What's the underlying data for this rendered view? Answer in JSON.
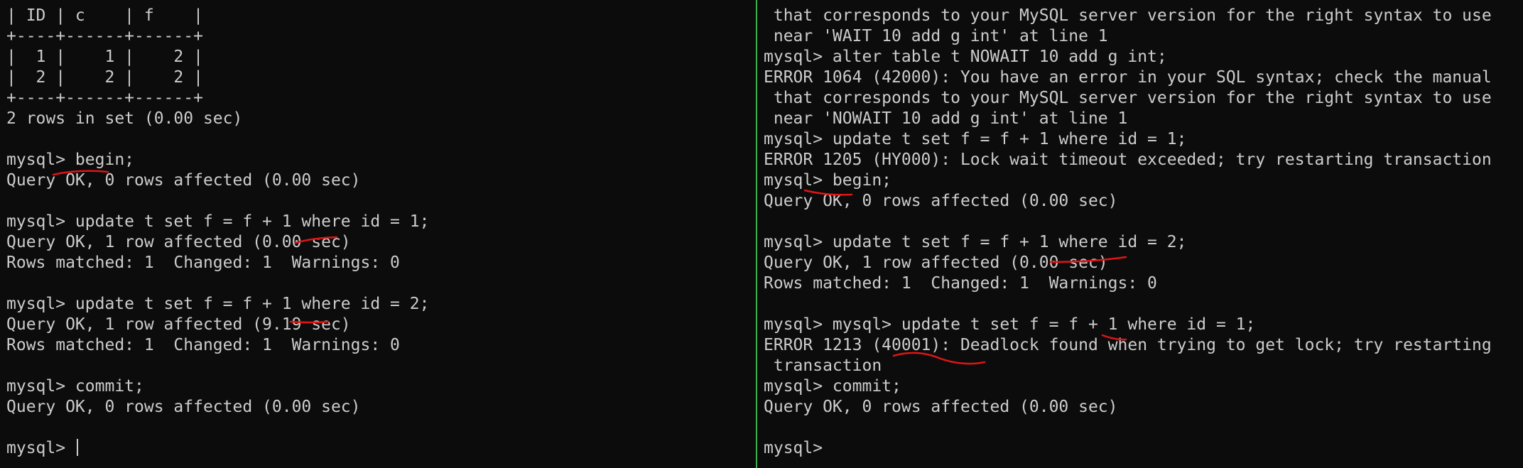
{
  "left_pane": {
    "lines": [
      "| ID | c    | f    |",
      "+----+------+------+",
      "|  1 |    1 |    2 |",
      "|  2 |    2 |    2 |",
      "+----+------+------+",
      "2 rows in set (0.00 sec)",
      "",
      "mysql> begin;",
      "Query OK, 0 rows affected (0.00 sec)",
      "",
      "mysql> update t set f = f + 1 where id = 1;",
      "Query OK, 1 row affected (0.00 sec)",
      "Rows matched: 1  Changed: 1  Warnings: 0",
      "",
      "mysql> update t set f = f + 1 where id = 2;",
      "Query OK, 1 row affected (9.19 sec)",
      "Rows matched: 1  Changed: 1  Warnings: 0",
      "",
      "mysql> commit;",
      "Query OK, 0 rows affected (0.00 sec)",
      "",
      "mysql> "
    ]
  },
  "right_pane": {
    "lines": [
      " that corresponds to your MySQL server version for the right syntax to use",
      " near 'WAIT 10 add g int' at line 1",
      "mysql> alter table t NOWAIT 10 add g int;",
      "ERROR 1064 (42000): You have an error in your SQL syntax; check the manual",
      " that corresponds to your MySQL server version for the right syntax to use",
      " near 'NOWAIT 10 add g int' at line 1",
      "mysql> update t set f = f + 1 where id = 1;",
      "ERROR 1205 (HY000): Lock wait timeout exceeded; try restarting transaction",
      "mysql> begin;",
      "Query OK, 0 rows affected (0.00 sec)",
      "",
      "mysql> update t set f = f + 1 where id = 2;",
      "Query OK, 1 row affected (0.00 sec)",
      "Rows matched: 1  Changed: 1  Warnings: 0",
      "",
      "mysql> mysql> update t set f = f + 1 where id = 1;",
      "ERROR 1213 (40001): Deadlock found when trying to get lock; try restarting",
      " transaction",
      "mysql> commit;",
      "Query OK, 0 rows affected (0.00 sec)",
      "",
      "mysql>"
    ]
  },
  "colors": {
    "background": "#0c0c0c",
    "text": "#cccccc",
    "divider": "#3fae4e",
    "annotation": "#e01515"
  }
}
